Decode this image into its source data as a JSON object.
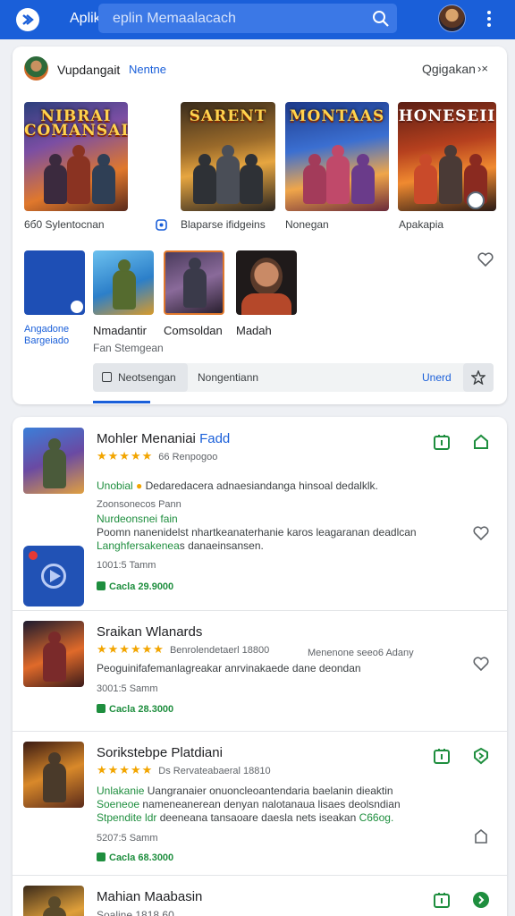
{
  "colors": {
    "brand": "#1a5fd9",
    "accent_green": "#1e8e3e",
    "star": "#f2a500"
  },
  "topbar": {
    "title": "Apliks",
    "search_placeholder": "eplin Memaalacach",
    "icons": [
      "app-logo-icon",
      "search-icon",
      "avatar",
      "more-vertical-icon"
    ]
  },
  "featured": {
    "user": "Vupdangait",
    "link": "Nentne",
    "right_label": "Qgigakan",
    "close": "›×",
    "games": [
      {
        "title": "NIBRAI COMANSAI",
        "caption": "6б0   Sylentocnan"
      },
      {
        "title": "SARENT",
        "caption": "Blaparse ifidgeins"
      },
      {
        "title": "MONTAAS",
        "caption": "Nonegan"
      },
      {
        "title": "HONESEII",
        "caption": "Apakapia"
      }
    ],
    "tiles": [
      {
        "caption": "Angadone Bargeiado"
      },
      {
        "caption": "Nmadantir"
      },
      {
        "caption": "Comsoldan"
      },
      {
        "caption": "Madah"
      }
    ],
    "tile_subcaption": "Fan Stemgean",
    "tabs": {
      "active": "Neotsengan",
      "second": "Nongentiann",
      "link": "Unerd"
    }
  },
  "list": [
    {
      "title": "Mohler Menaniai",
      "tag": "Fadd",
      "stars": "★★★★★",
      "meta": "66  Renpogoo",
      "desc_lead": "Unobial",
      "desc": "Dedaredacera adnaesiandanga hinsoal dedalklk.",
      "line2": "Zoonsonecos Pann",
      "line3_green": "Nurdeonsnei fain",
      "line4": "Poomn nanenidelst nhartkeanaterhanie karos leagaranan deadlcan",
      "line5_green": "Langhfersakenea",
      "line5": "s danaeinsansen.",
      "size": "1001:5  Tamm",
      "price": "Cacla  29.9000"
    },
    {
      "title": "Sraikan Wlanards",
      "stars": "★★★★★★",
      "meta": "Benrolendetaerl 18800",
      "meta2": "Menenone seeo6 Adany",
      "desc": "Peoguinifafemanlagreakar anrvinakaede dane deondan",
      "size": "3001:5  Samm",
      "price": "Cacla  28.3000"
    },
    {
      "title": "Sorikstebpe Platdiani",
      "stars": "★★★★★",
      "meta": "Ds Rervateabaeral 18810",
      "line1_green": "Unlakanie",
      "line1": "Uangranaier onuoncleoantendaria baelanin dieaktin",
      "line2_green": "Soeneoe",
      "line2": "nameneanerean denyan nalotanaua lisaes deolsndian",
      "line3_green": "Stpendite ldr",
      "line3": "deeneana tansaoare daesla nets iseakan",
      "line3_end": "C66og.",
      "size": "5207:5  Samm",
      "price": "Cacla  68.3000"
    },
    {
      "title": "Mahian Maabasin",
      "sub": "Soaline 1818 60"
    }
  ]
}
